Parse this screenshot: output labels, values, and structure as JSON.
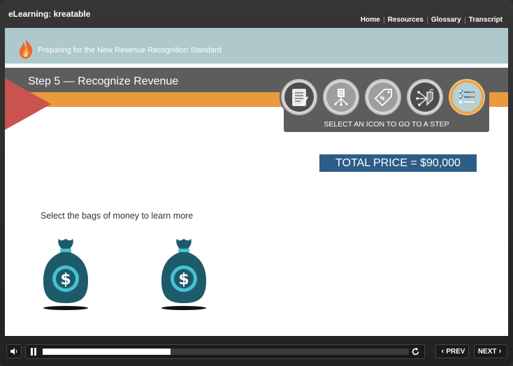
{
  "app": {
    "title": "eLearning: kreatable"
  },
  "nav": {
    "home": "Home",
    "resources": "Resources",
    "glossary": "Glossary",
    "transcript": "Transcript"
  },
  "banner": {
    "course_title": "Preparing for the New Revenue Recognition Standard"
  },
  "step": {
    "title": "Step 5 — Recognize Revenue"
  },
  "step_icons": {
    "caption": "SELECT AN ICON TO GO TO A STEP",
    "items": [
      {
        "icon": "contract-document-icon",
        "step": 1
      },
      {
        "icon": "performance-obligations-icon",
        "step": 2
      },
      {
        "icon": "price-tag-icon",
        "step": 3
      },
      {
        "icon": "allocate-price-icon",
        "step": 4
      },
      {
        "icon": "checklist-icon",
        "step": 5,
        "active": true
      }
    ]
  },
  "total_price": "TOTAL PRICE = $90,000",
  "prompt": "Select the bags of money to learn more",
  "bags": [
    {
      "icon": "money-bag-icon"
    },
    {
      "icon": "money-bag-icon"
    }
  ],
  "player": {
    "progress_percent": 35,
    "prev_label": "PREV",
    "next_label": "NEXT"
  },
  "colors": {
    "banner": "#aec8cc",
    "step_bar": "#5d5d5d",
    "orange": "#e99a3d",
    "red_accent": "#c9534f",
    "total_box": "#2c5d86",
    "bag": "#1e5b6a",
    "bag_accent": "#46c1d4"
  }
}
